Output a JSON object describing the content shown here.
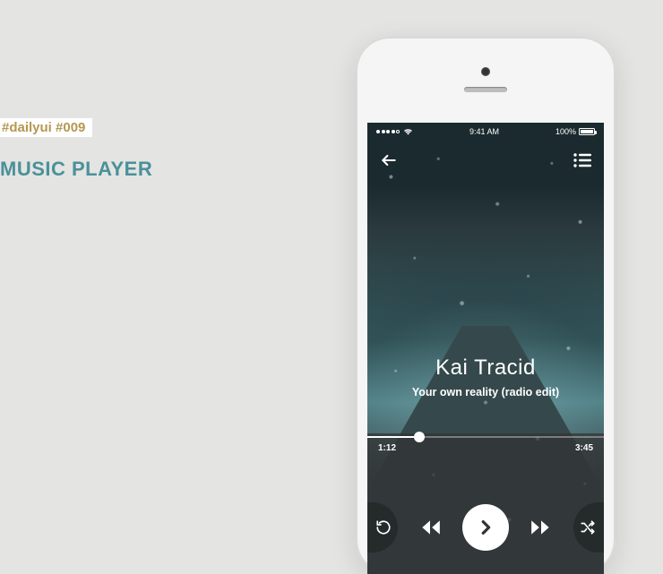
{
  "page": {
    "hashtag": "#dailyui #009",
    "title": "MUSIC PLAYER"
  },
  "statusbar": {
    "time": "9:41 AM",
    "battery": "100%"
  },
  "player": {
    "artist": "Kai Tracid",
    "track": "Your own reality (radio edit)",
    "elapsed": "1:12",
    "duration": "3:45"
  }
}
